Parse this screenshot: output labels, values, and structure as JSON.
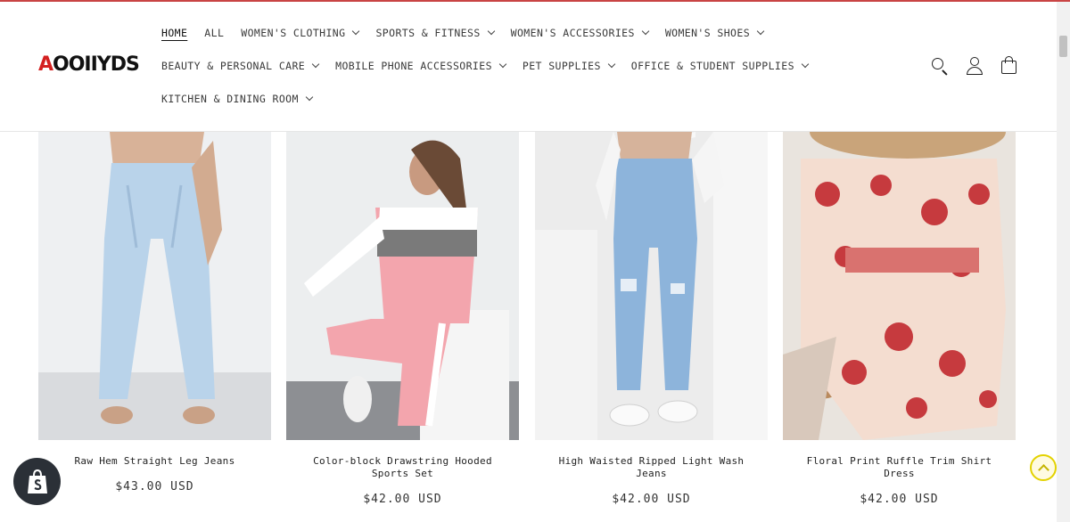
{
  "brand": {
    "logo_text_a": "A",
    "logo_text_rest": "OOIIYDS",
    "accent": "#d42020"
  },
  "nav": {
    "row1": [
      {
        "label": "HOME",
        "active": true,
        "dropdown": false
      },
      {
        "label": "ALL",
        "dropdown": false
      },
      {
        "label": "WOMEN'S CLOTHING",
        "dropdown": true
      },
      {
        "label": "SPORTS & FITNESS",
        "dropdown": true
      },
      {
        "label": "WOMEN'S ACCESSORIES",
        "dropdown": true
      },
      {
        "label": "WOMEN'S SHOES",
        "dropdown": true
      }
    ],
    "row2": [
      {
        "label": "BEAUTY & PERSONAL CARE",
        "dropdown": true
      },
      {
        "label": "MOBILE PHONE ACCESSORIES",
        "dropdown": true
      },
      {
        "label": "PET SUPPLIES",
        "dropdown": true
      },
      {
        "label": "OFFICE & STUDENT SUPPLIES",
        "dropdown": true
      }
    ],
    "row3": [
      {
        "label": "KITCHEN & DINING ROOM",
        "dropdown": true
      }
    ]
  },
  "header_icons": [
    "search-icon",
    "account-icon",
    "cart-icon"
  ],
  "products": [
    {
      "title": "Raw Hem Straight Leg Jeans",
      "price": "$43.00 USD"
    },
    {
      "title": "Color-block Drawstring Hooded Sports Set",
      "price": "$42.00 USD"
    },
    {
      "title": "High Waisted Ripped Light Wash Jeans",
      "price": "$42.00 USD"
    },
    {
      "title": "Floral Print Ruffle Trim Shirt Dress",
      "price": "$42.00 USD"
    }
  ],
  "colors": {
    "top_line": "#c94444",
    "scroll_top_button": "#e3d200",
    "shopify_badge": "#2b3037"
  }
}
